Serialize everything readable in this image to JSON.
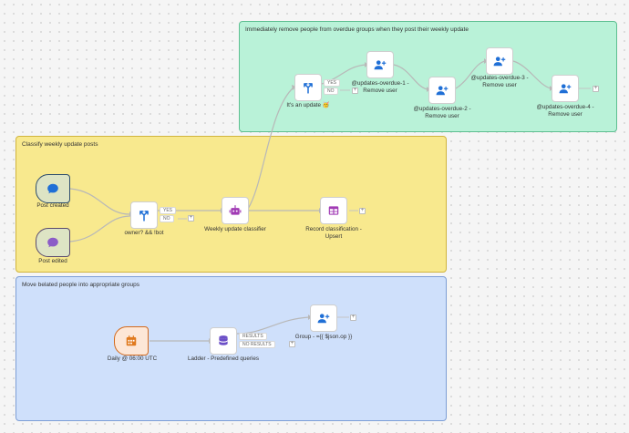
{
  "groups": {
    "green_title": "Immediately remove people from overdue groups when they post their weekly update",
    "yellow_title": "Classify weekly update posts",
    "blue_title": "Move belated people into appropriate groups"
  },
  "nodes": {
    "post_created": "Post created",
    "post_edited": "Post edited",
    "owner_check": "owner? && !bot",
    "weekly_classifier": "Weekly update classifier",
    "record_classification_line1": "Record classification -",
    "record_classification_line2": "Upsert",
    "its_an_update": "It's an update 🥳",
    "overdue1_line1": "@updates-overdue-1 -",
    "overdue1_line2": "Remove user",
    "overdue2_line1": "@updates-overdue-2 -",
    "overdue2_line2": "Remove user",
    "overdue3_line1": "@updates-overdue-3 -",
    "overdue3_line2": "Remove user",
    "overdue4_line1": "@updates-overdue-4 -",
    "overdue4_line2": "Remove user",
    "daily": "Daily @ 06:00 UTC",
    "ladder": "Ladder - Predefined queries",
    "group_op": "Group - ={{ $json.op }}"
  },
  "branches": {
    "yes": "YES",
    "no": "NO",
    "results": "RESULTS",
    "no_results": "NO RESULTS"
  },
  "plus_symbol": "+",
  "icons": {
    "post_created": "chat-bubble-icon",
    "post_edited": "chat-bubble-icon",
    "if": "branch-split-icon",
    "classifier": "robot-icon",
    "record": "table-icon",
    "remove_user": "person-plus-icon",
    "schedule": "calendar-icon",
    "ladder": "database-icon"
  },
  "colors": {
    "green_group": "#b9f2d8",
    "yellow_group": "#f8e98e",
    "blue_group": "#cfe0fb",
    "icon_blue": "#1f6fd6",
    "icon_purple": "#a13bb5",
    "icon_orange": "#e07a1f",
    "wire": "#b8b8b8"
  }
}
